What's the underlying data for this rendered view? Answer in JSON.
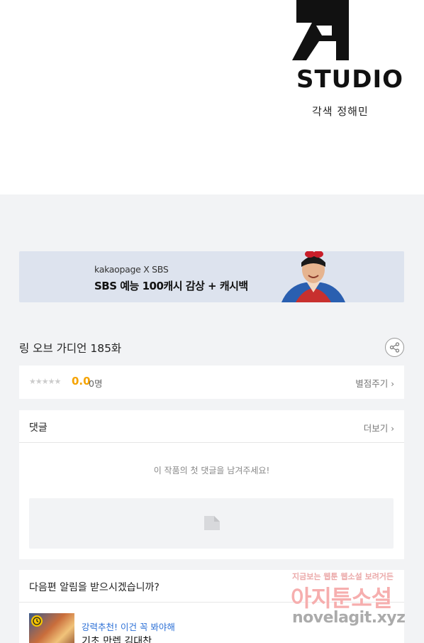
{
  "header": {
    "studio_label": "STUDIO",
    "credit": "각색 정해민"
  },
  "banner": {
    "brand": "kakaopage X SBS",
    "text": "SBS 예능 100캐시 감상 + 캐시백"
  },
  "episode": {
    "title": "링 오브 가디언 185화"
  },
  "rating": {
    "stars": "★★★★★",
    "score": "0.0",
    "count": "0명",
    "rate_label": "별점주기",
    "rate_chevron": "›"
  },
  "comments": {
    "title": "댓글",
    "more_label": "더보기",
    "more_chevron": "›",
    "empty_message": "이 작품의 첫 댓글을 남겨주세요!"
  },
  "notify": {
    "question": "다음편 알림을 받으시겠습니까?",
    "rec_tag": "강력추천! 이건 꼭 봐야해",
    "rec_title": "기초 만렙 김대찬"
  },
  "watermark": {
    "line1": "지금보는 웹툰 웹소설 보려거든",
    "line2": "아지툰소설",
    "url": "novelagit.xyz"
  },
  "icons": {
    "share": "share-icon",
    "comment_input": "pencil-icon",
    "rec_badge": "clock-icon"
  },
  "colors": {
    "score": "#f5a300",
    "rec_tag": "#2b6fd6",
    "banner_bg": "#dde3ee",
    "page_bg": "#f2f3f5"
  }
}
